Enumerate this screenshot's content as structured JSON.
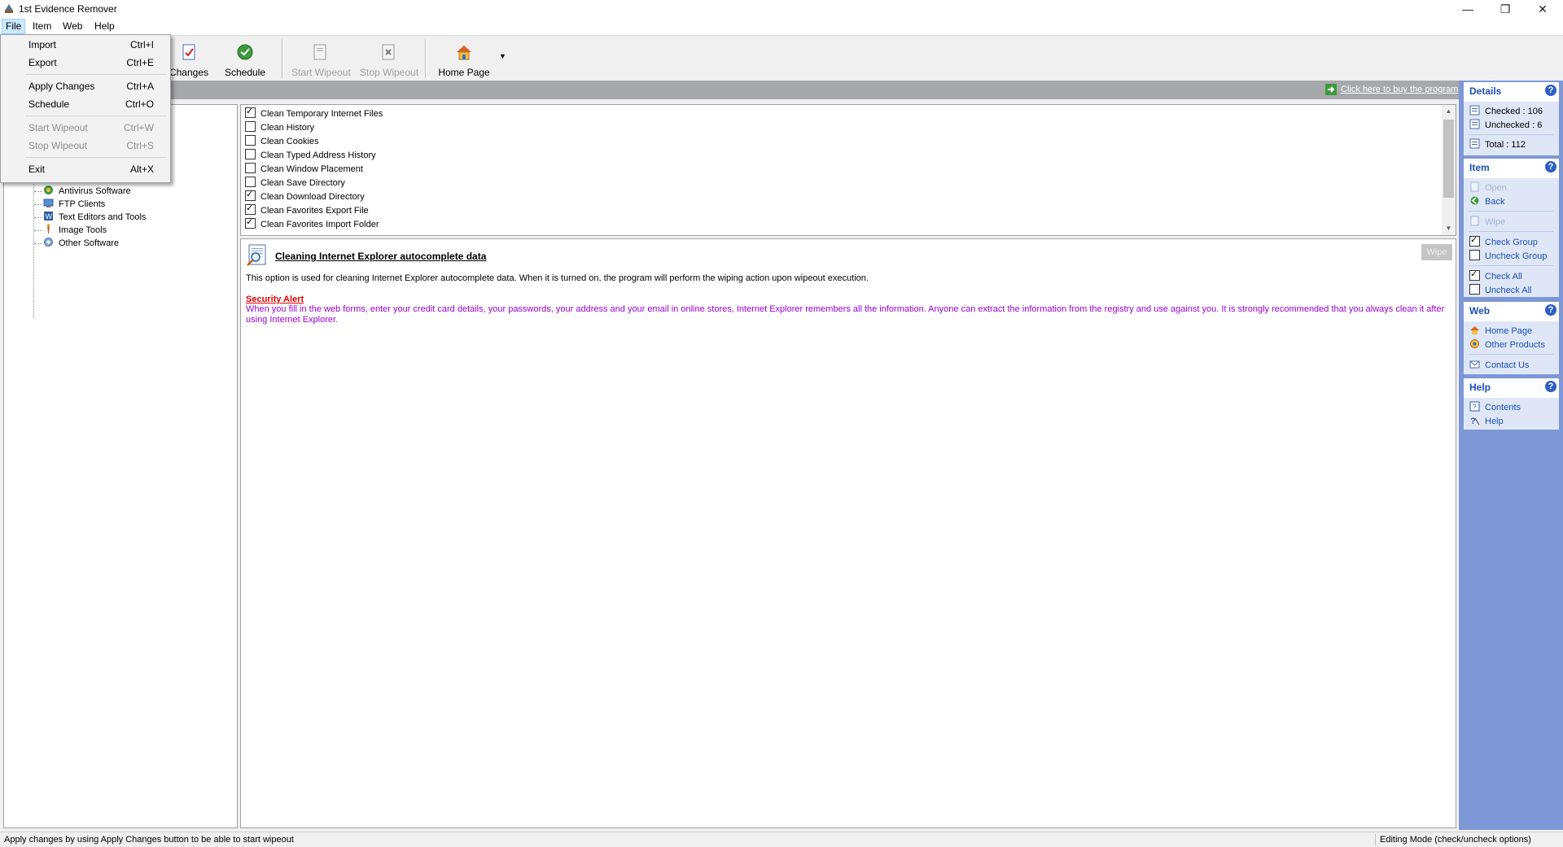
{
  "window": {
    "title": "1st Evidence Remover",
    "minimize": "—",
    "restore": "❐",
    "close": "✕"
  },
  "menubar": {
    "file": "File",
    "item": "Item",
    "web": "Web",
    "help": "Help"
  },
  "file_menu": {
    "items": [
      {
        "label": "Import",
        "shortcut": "Ctrl+I",
        "enabled": true
      },
      {
        "label": "Export",
        "shortcut": "Ctrl+E",
        "enabled": true
      },
      {
        "label": "Apply Changes",
        "shortcut": "Ctrl+A",
        "enabled": true
      },
      {
        "label": "Schedule",
        "shortcut": "Ctrl+O",
        "enabled": true
      },
      {
        "label": "Start Wipeout",
        "shortcut": "Ctrl+W",
        "enabled": false
      },
      {
        "label": "Stop Wipeout",
        "shortcut": "Ctrl+S",
        "enabled": false
      },
      {
        "label": "Exit",
        "shortcut": "Alt+X",
        "enabled": true
      }
    ]
  },
  "toolbar": {
    "apply_changes": "Changes",
    "schedule": "Schedule",
    "start_wipeout": "Start Wipeout",
    "stop_wipeout": "Stop Wipeout",
    "home_page": "Home Page"
  },
  "band": {
    "buy_link": "Click here to buy the program"
  },
  "tree": {
    "items": [
      {
        "label": "Antivirus Software",
        "icon": "antivirus-icon"
      },
      {
        "label": "FTP Clients",
        "icon": "ftp-icon"
      },
      {
        "label": "Text Editors and Tools",
        "icon": "text-editor-icon"
      },
      {
        "label": "Image Tools",
        "icon": "image-tools-icon"
      },
      {
        "label": "Other Software",
        "icon": "other-software-icon"
      }
    ]
  },
  "options": {
    "items": [
      {
        "label": "Clean Temporary Internet Files",
        "checked": true
      },
      {
        "label": "Clean History",
        "checked": false
      },
      {
        "label": "Clean Cookies",
        "checked": false
      },
      {
        "label": "Clean Typed Address History",
        "checked": false
      },
      {
        "label": "Clean Window Placement",
        "checked": false
      },
      {
        "label": "Clean Save Directory",
        "checked": false
      },
      {
        "label": "Clean Download Directory",
        "checked": true
      },
      {
        "label": "Clean Favorites Export File",
        "checked": true
      },
      {
        "label": "Clean Favorites Import Folder",
        "checked": true
      }
    ]
  },
  "description": {
    "title": "Cleaning Internet Explorer autocomplete data",
    "body": "This option is used for cleaning Internet Explorer autocomplete data. When it is turned on, the program will perform the wiping action upon wipeout execution.",
    "alert_title": "Security Alert",
    "alert_body": "When you fill in the web forms, enter your credit card details, your passwords, your address and your email in online stores, Internet Explorer remembers all the information. Anyone can extract the information from the registry and use against you. It is strongly recommended that you always clean it after using Internet Explorer.",
    "wipe_button": "Wipe"
  },
  "details": {
    "title": "Details",
    "checked": "Checked : 106",
    "unchecked": "Unchecked : 6",
    "total": "Total : 112"
  },
  "item_panel": {
    "title": "Item",
    "open": "Open",
    "back": "Back",
    "wipe": "Wipe",
    "check_group": "Check Group",
    "uncheck_group": "Uncheck Group",
    "check_all": "Check All",
    "uncheck_all": "Uncheck All"
  },
  "web_panel": {
    "title": "Web",
    "home_page": "Home Page",
    "other_products": "Other Products",
    "contact_us": "Contact Us"
  },
  "help_panel": {
    "title": "Help",
    "contents": "Contents",
    "help": "Help"
  },
  "status": {
    "left": "Apply changes by using Apply Changes button to be able to start wipeout",
    "right": "Editing Mode (check/uncheck options)"
  },
  "colors": {
    "accent_blue": "#1b4fb6",
    "side_panel": "#7e97d6",
    "alert_red": "#e00000",
    "alert_purple": "#9b00d3"
  }
}
